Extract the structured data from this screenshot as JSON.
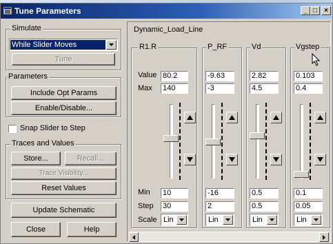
{
  "window": {
    "title": "Tune Parameters",
    "minimize_glyph": "_",
    "restore_glyph": "□",
    "close_glyph": "×"
  },
  "simulate": {
    "group_label": "Simulate",
    "mode_value": "While Slider Moves",
    "tune_label": "Tune"
  },
  "parameters": {
    "group_label": "Parameters",
    "include_opt_label": "Include Opt Params",
    "enable_disable_label": "Enable/Disable..."
  },
  "snap": {
    "label": "Snap Slider to Step",
    "checked": false
  },
  "traces": {
    "group_label": "Traces and Values",
    "store_label": "Store...",
    "recall_label": "Recall...",
    "trace_visibility_label": "Trace Visibility...",
    "reset_label": "Reset Values"
  },
  "update_schematic_label": "Update Schematic",
  "close_label": "Close",
  "help_label": "Help",
  "panel": {
    "title": "Dynamic_Load_Line",
    "row_labels": {
      "value": "Value",
      "max": "Max",
      "min": "Min",
      "step": "Step",
      "scale": "Scale"
    },
    "columns": [
      {
        "name": "R1.R",
        "value": "80.2",
        "max": "140",
        "min": "10",
        "step": "30",
        "scale": "Lin",
        "slider_fraction": 0.54
      },
      {
        "name": "P_RF",
        "value": "-9.63",
        "max": "-3",
        "min": "-16",
        "step": "2",
        "scale": "Lin",
        "slider_fraction": 0.49
      },
      {
        "name": "Vd",
        "value": "2.82",
        "max": "4.5",
        "min": "0.5",
        "step": "0.5",
        "scale": "Lin",
        "slider_fraction": 0.58
      },
      {
        "name": "Vgstep",
        "value": "0.103",
        "max": "0.4",
        "min": "0.1",
        "step": "0.05",
        "scale": "Lin",
        "slider_fraction": 0.01
      }
    ]
  },
  "icons": {
    "title_icon": "tune-parameters-icon",
    "dropdown": "chevron-down-icon",
    "spin_up": "arrow-up-icon",
    "spin_down": "arrow-down-icon",
    "scroll_left": "arrow-left-icon",
    "scroll_right": "arrow-right-icon",
    "cursor": "mouse-pointer-icon"
  },
  "colors": {
    "titlebar": "#0a246a",
    "face": "#d4d0c8",
    "selection": "#0a246a"
  }
}
